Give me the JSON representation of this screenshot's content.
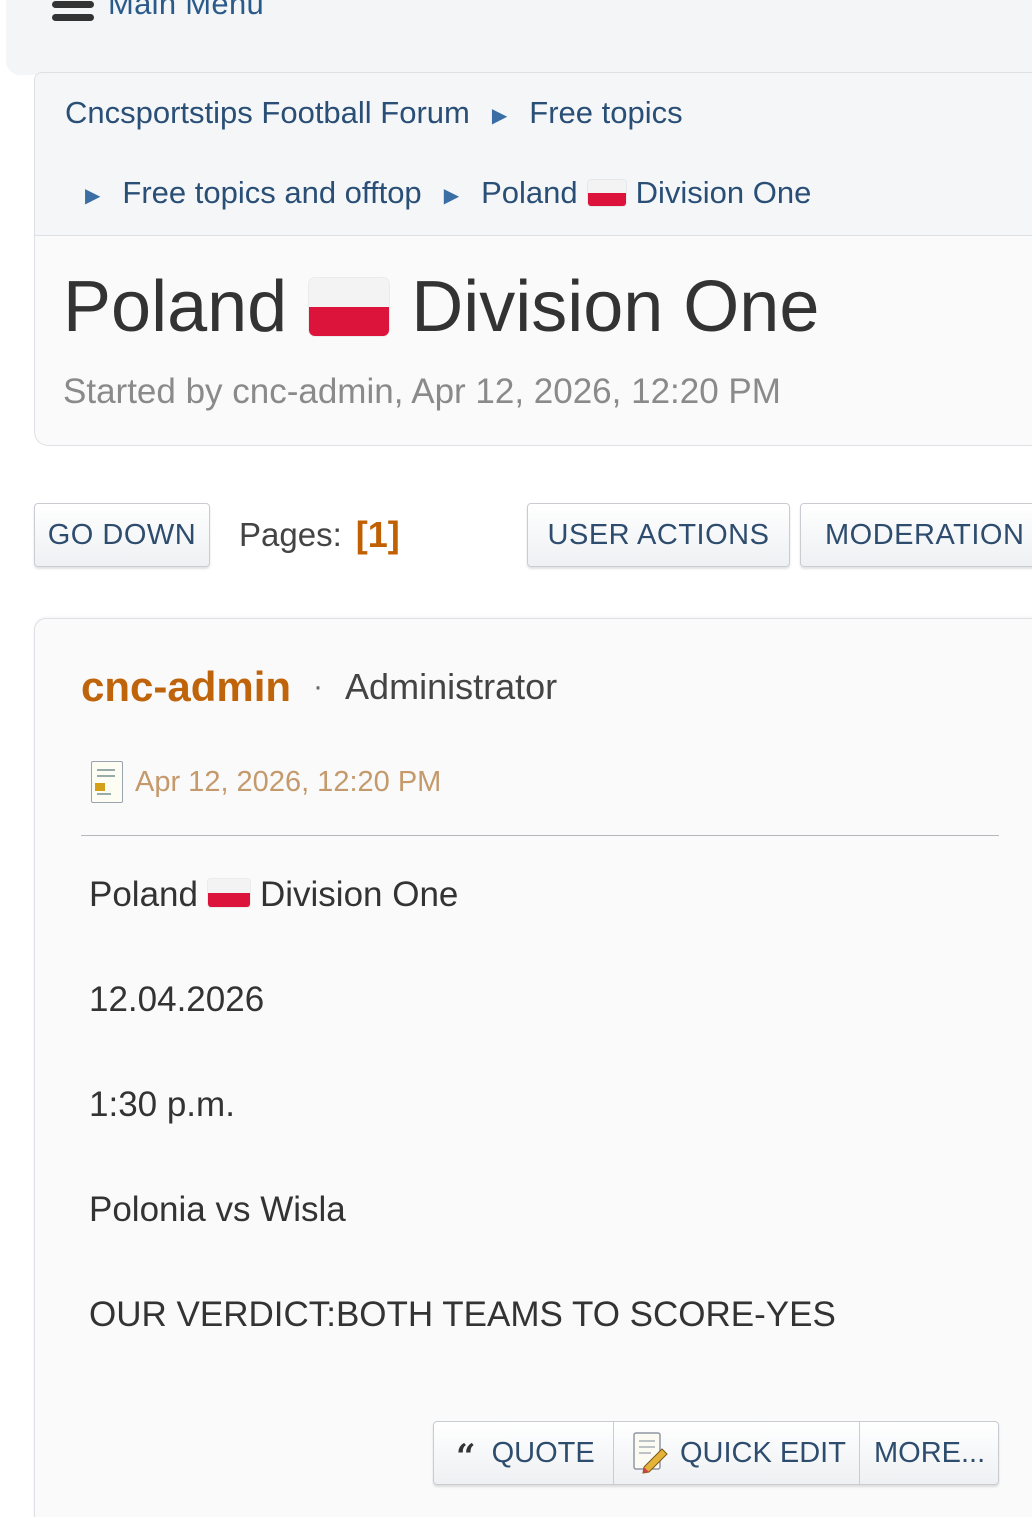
{
  "topbar": {
    "menu_label": "Main Menu"
  },
  "breadcrumb": {
    "items": [
      "Cncsportstips Football Forum",
      "Free topics",
      "Free topics and offtop"
    ],
    "current_prefix": "Poland",
    "current_suffix": "Division One"
  },
  "topic": {
    "title_prefix": "Poland",
    "title_suffix": "Division One",
    "meta": "Started by cnc-admin, Apr 12, 2026, 12:20 PM"
  },
  "toolbar": {
    "go_down": "GO DOWN",
    "pages_label": "Pages:",
    "current_page": "[1]",
    "user_actions": "USER ACTIONS",
    "moderation": "MODERATION"
  },
  "post": {
    "author": "cnc-admin",
    "separator": "·",
    "role": "Administrator",
    "date": "Apr 12, 2026, 12:20 PM",
    "body": {
      "line1_prefix": "Poland",
      "line1_suffix": "Division One",
      "line2": "12.04.2026",
      "line3": "1:30 p.m.",
      "line4": "Polonia vs Wisla",
      "line5": "OUR VERDICT:BOTH TEAMS TO SCORE-YES"
    },
    "actions": {
      "quote": "QUOTE",
      "quick_edit": "QUICK EDIT",
      "more": "MORE..."
    }
  },
  "icons": {
    "menu": "hamburger-icon",
    "breadcrumb_separator": "triangle-right-icon",
    "flag": "poland-flag-icon",
    "post_date": "document-icon",
    "quote": "quote-icon",
    "quick_edit": "edit-document-icon"
  },
  "colors": {
    "accent_link": "#2a4f76",
    "author": "#c0640c",
    "current_page": "#c06000",
    "date": "#c49a6c",
    "flag_red": "#dc143c"
  }
}
